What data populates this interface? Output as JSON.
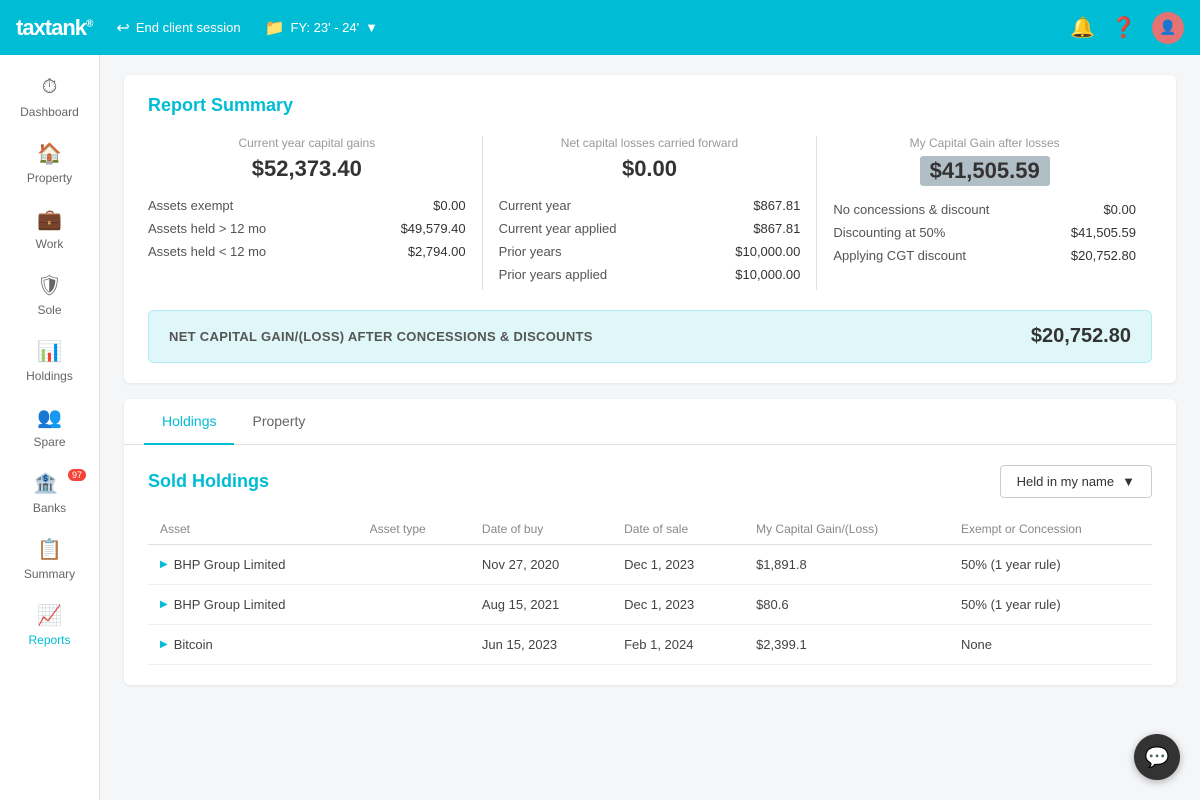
{
  "topnav": {
    "logo": "taxtank",
    "logo_reg": "®",
    "end_session_label": "End client session",
    "fy_label": "FY: 23' - 24'",
    "fy_icon": "▼"
  },
  "sidebar": {
    "items": [
      {
        "id": "dashboard",
        "label": "Dashboard",
        "icon": "⏱",
        "active": false
      },
      {
        "id": "property",
        "label": "Property",
        "icon": "🏠",
        "active": false
      },
      {
        "id": "work",
        "label": "Work",
        "icon": "💼",
        "active": false
      },
      {
        "id": "sole",
        "label": "Sole",
        "icon": "🛡",
        "active": false
      },
      {
        "id": "holdings",
        "label": "Holdings",
        "icon": "📊",
        "active": false
      },
      {
        "id": "spare",
        "label": "Spare",
        "icon": "👥",
        "active": false
      },
      {
        "id": "banks",
        "label": "Banks",
        "icon": "🏦",
        "active": false,
        "badge": "97"
      },
      {
        "id": "summary",
        "label": "Summary",
        "icon": "📋",
        "active": false
      },
      {
        "id": "reports",
        "label": "Reports",
        "icon": "📈",
        "active": true
      }
    ]
  },
  "report_summary": {
    "title": "Report Summary",
    "columns": [
      {
        "header": "Current year capital gains",
        "value": "$52,373.40",
        "highlighted": false,
        "rows": [
          {
            "label": "Assets exempt",
            "value": "$0.00"
          },
          {
            "label": "Assets held > 12 mo",
            "value": "$49,579.40"
          },
          {
            "label": "Assets held < 12 mo",
            "value": "$2,794.00"
          }
        ]
      },
      {
        "header": "Net capital losses carried forward",
        "value": "$0.00",
        "highlighted": false,
        "rows": [
          {
            "label": "Current year",
            "value": "$867.81"
          },
          {
            "label": "Current year applied",
            "value": "$867.81"
          },
          {
            "label": "Prior years",
            "value": "$10,000.00"
          },
          {
            "label": "Prior years applied",
            "value": "$10,000.00"
          }
        ]
      },
      {
        "header": "My Capital Gain after losses",
        "value": "$41,505.59",
        "highlighted": true,
        "rows": [
          {
            "label": "No concessions & discount",
            "value": "$0.00"
          },
          {
            "label": "Discounting at 50%",
            "value": "$41,505.59"
          },
          {
            "label": "Applying CGT discount",
            "value": "$20,752.80"
          }
        ]
      }
    ],
    "net_gain_label": "NET CAPITAL GAIN/(LOSS) AFTER CONCESSIONS & DISCOUNTS",
    "net_gain_value": "$20,752.80"
  },
  "tabs": {
    "items": [
      {
        "id": "holdings",
        "label": "Holdings",
        "active": true
      },
      {
        "id": "property",
        "label": "Property",
        "active": false
      }
    ]
  },
  "sold_holdings": {
    "title": "Sold Holdings",
    "dropdown_label": "Held in my name",
    "columns": [
      {
        "key": "asset",
        "label": "Asset"
      },
      {
        "key": "asset_type",
        "label": "Asset type"
      },
      {
        "key": "date_of_buy",
        "label": "Date of buy"
      },
      {
        "key": "date_of_sale",
        "label": "Date of sale"
      },
      {
        "key": "capital_gain",
        "label": "My Capital Gain/(Loss)"
      },
      {
        "key": "exempt",
        "label": "Exempt or Concession"
      }
    ],
    "rows": [
      {
        "asset": "BHP Group Limited",
        "asset_type": "",
        "date_of_buy": "Nov 27, 2020",
        "date_of_sale": "Dec 1, 2023",
        "capital_gain": "$1,891.8",
        "exempt": "50% (1 year rule)"
      },
      {
        "asset": "BHP Group Limited",
        "asset_type": "",
        "date_of_buy": "Aug 15, 2021",
        "date_of_sale": "Dec 1, 2023",
        "capital_gain": "$80.6",
        "exempt": "50% (1 year rule)"
      },
      {
        "asset": "Bitcoin",
        "asset_type": "",
        "date_of_buy": "Jun 15, 2023",
        "date_of_sale": "Feb 1, 2024",
        "capital_gain": "$2,399.1",
        "exempt": "None"
      }
    ]
  }
}
